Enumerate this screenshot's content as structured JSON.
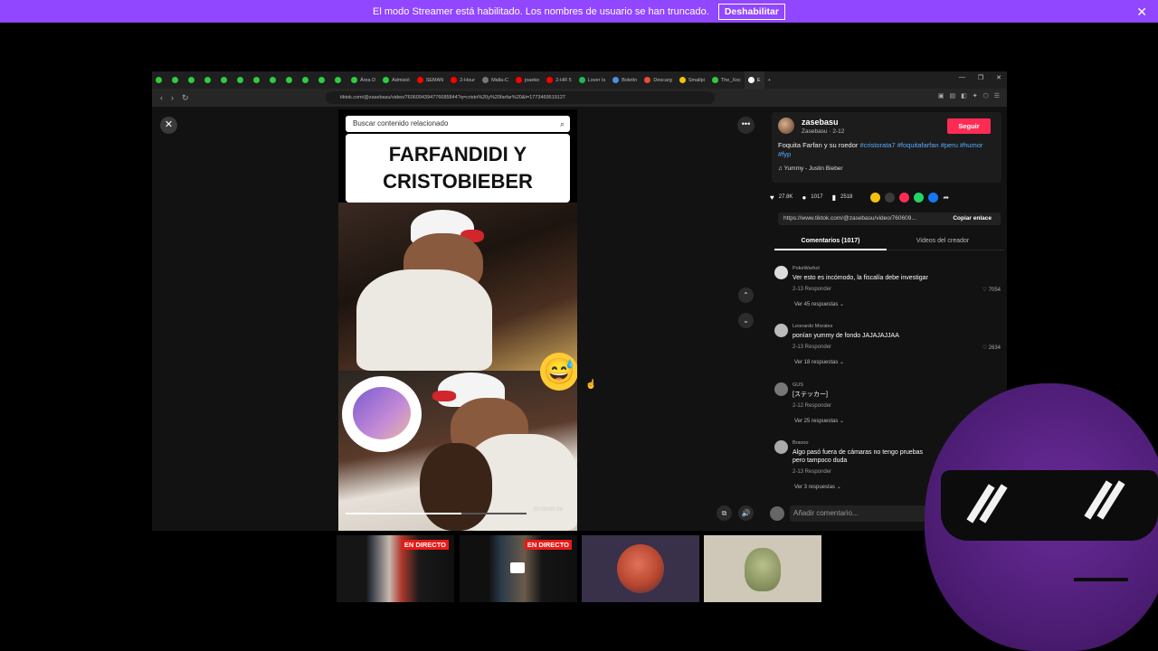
{
  "banner": {
    "message": "El modo Streamer está habilitado. Los nombres de usuario se han truncado.",
    "button": "Deshabilitar",
    "close": "✕"
  },
  "browser": {
    "tabs": [
      {
        "label": "",
        "color": "#2ecc40"
      },
      {
        "label": "",
        "color": "#2ecc40"
      },
      {
        "label": "",
        "color": "#2ecc40"
      },
      {
        "label": "",
        "color": "#2ecc40"
      },
      {
        "label": "",
        "color": "#2ecc40"
      },
      {
        "label": "",
        "color": "#2ecc40"
      },
      {
        "label": "",
        "color": "#2ecc40"
      },
      {
        "label": "",
        "color": "#2ecc40"
      },
      {
        "label": "",
        "color": "#2ecc40"
      },
      {
        "label": "",
        "color": "#2ecc40"
      },
      {
        "label": "",
        "color": "#2ecc40"
      },
      {
        "label": "",
        "color": "#2ecc40"
      },
      {
        "label": "Área D",
        "color": "#2ecc40"
      },
      {
        "label": "Admisió",
        "color": "#2ecc40"
      },
      {
        "label": "SEMAN",
        "color": "#ff0000"
      },
      {
        "label": "2-Hour",
        "color": "#ff0000"
      },
      {
        "label": "Malla-C",
        "color": "#777777"
      },
      {
        "label": "joaeko",
        "color": "#ff0000"
      },
      {
        "label": "2-HR 5",
        "color": "#ff0000"
      },
      {
        "label": "Lover Is",
        "color": "#1db954"
      },
      {
        "label": "Boletín",
        "color": "#4a90e2"
      },
      {
        "label": "Descarg",
        "color": "#e74c3c"
      },
      {
        "label": "Smallpi",
        "color": "#f1c40f"
      },
      {
        "label": "The_Xoc",
        "color": "#2ecc40"
      },
      {
        "label": "E",
        "color": "#ffffff",
        "active": true
      }
    ],
    "new_tab": "+",
    "url": "tiktok.com/@zasebasu/video/7606094394776685844?q=cristo%20y%20farfar%20&t=1773469519127"
  },
  "video": {
    "search_placeholder": "Buscar contenido relacionado",
    "title": "FARFANDIDI Y CRISTOBIEBER",
    "emoji": "😅",
    "time": "00:00/00:59",
    "progress": 0.64
  },
  "creator": {
    "username": "zasebasu",
    "subline": "Zasebasu · 2-12",
    "follow": "Seguir",
    "desc_text": "Foquita Farfan y su roedor ",
    "hashtags": "#cristorata7 #foquitafarfan #peru #humor #fyp",
    "music": "♫  Yummy - Justin Bieber"
  },
  "stats": {
    "likes": "27.8K",
    "comments": "1017",
    "saves": "2518"
  },
  "share": {
    "colors": [
      "#f4c20d",
      "#3a3a3a",
      "#fe2c55",
      "#25d366",
      "#1877f2"
    ],
    "link": "https://www.tiktok.com/@zasebasu/video/760609...",
    "copy": "Copiar enlace"
  },
  "tabs": {
    "comments": "Comentarios (1017)",
    "creator_videos": "Videos del creador"
  },
  "comments": [
    {
      "user": "PokeWarhol",
      "text": "Ver esto es incómodo, la fiscalía debe investigar",
      "meta": "2-13   Responder",
      "likes": "♡ 7054",
      "replies": "Ver 45 respuestas ⌄"
    },
    {
      "user": "Leonardo Morales",
      "text": "ponían yummy de fondo JAJAJAJJAA",
      "meta": "2-13   Responder",
      "likes": "♡ 2634",
      "replies": "Ver 18 respuestas ⌄"
    },
    {
      "user": "GUS",
      "text": "[ステッカー]",
      "meta": "2-12   Responder",
      "likes": "",
      "replies": "Ver 25 respuestas ⌄"
    },
    {
      "user": "Bravoo",
      "text": "Algo pasó fuera de cámaras no tengo pruebas pero tampoco duda",
      "meta": "2-13   Responder",
      "likes": "",
      "replies": "Ver 3 respuestas ⌄"
    }
  ],
  "add_comment": "Añadir comentario...",
  "thumbnails": {
    "live1": "EN DIRECTO",
    "live2": "EN DIRECTO"
  },
  "colors": {
    "banner": "#9146ff",
    "follow": "#fe2c55",
    "live": "#e91916",
    "hashtag": "#5aa9ff"
  }
}
